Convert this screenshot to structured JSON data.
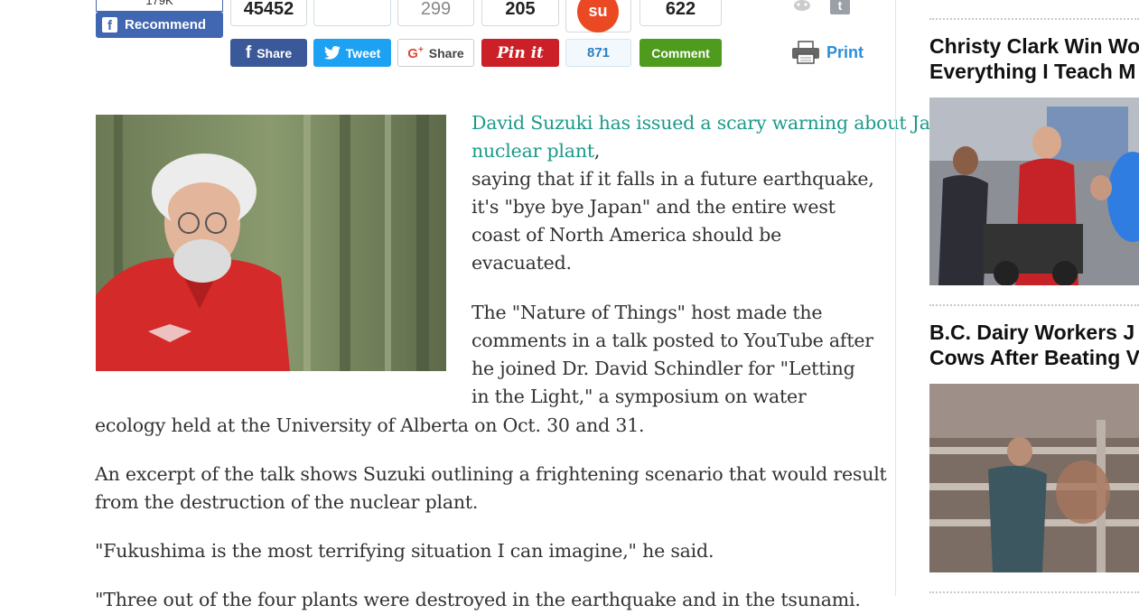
{
  "share_bar": {
    "recommend_count": "179K",
    "recommend_label": "Recommend",
    "facebook": {
      "count": "45452",
      "label": "Share"
    },
    "twitter": {
      "count": "",
      "label": "Tweet"
    },
    "googleplus": {
      "count": "299",
      "label": "Share"
    },
    "pinterest": {
      "count": "205",
      "label": "Pin it"
    },
    "stumbleupon": {
      "count": "871",
      "icon": "stumbleupon-icon"
    },
    "comment": {
      "count": "622",
      "label": "Comment"
    },
    "print_label": "Print"
  },
  "article": {
    "link_text": "David Suzuki has issued a scary warning about Japan's Fukushima nuclear plant",
    "p1_rest_lines": [
      ",",
      "saying that if it falls in a future earthquake,",
      "it's \"bye bye Japan\" and the entire west",
      "coast of North America should be",
      "evacuated."
    ],
    "p2_lines": [
      "The \"Nature of Things\" host made the",
      "comments in a talk posted to YouTube after",
      "he joined Dr. David Schindler for \"Letting",
      "in the Light,\" a symposium on water",
      "ecology held at the University of Alberta on Oct. 30 and 31."
    ],
    "p3_lines": [
      "An excerpt of the talk shows Suzuki outlining a frightening scenario that would result",
      "from the destruction of the nuclear plant."
    ],
    "p4": "\"Fukushima is the most terrifying situation I can imagine,\" he said.",
    "p5_partial": "\"Three out of the four plants were destroyed in the earthquake and in the tsunami."
  },
  "sidebar": {
    "items": [
      {
        "title_line1": "Christy Clark Win Wo",
        "title_line2": "Everything I Teach M"
      },
      {
        "title_line1": "B.C. Dairy Workers J",
        "title_line2": "Cows After Beating V"
      }
    ]
  },
  "colors": {
    "link": "#1a9a8a",
    "facebook": "#3b5998",
    "twitter": "#1da1f2",
    "pinterest": "#cb2027",
    "comment": "#4e9b1e",
    "print": "#2b8ed9"
  }
}
